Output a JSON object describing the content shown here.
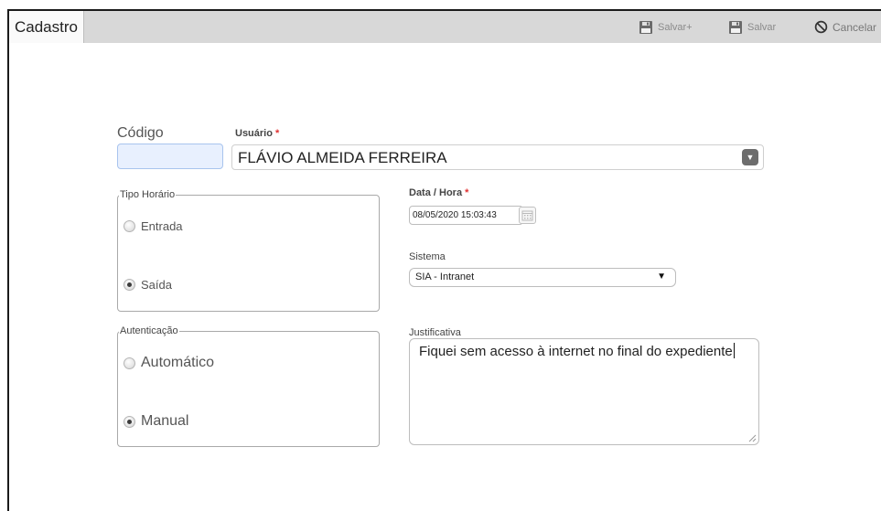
{
  "toolbar": {
    "tab_label": "Cadastro",
    "save_plus_label": "Salvar+",
    "save_label": "Salvar",
    "cancel_label": "Cancelar",
    "icons": {
      "save_plus": "floppy-disk-icon",
      "save": "floppy-disk-icon",
      "cancel": "circle-slash-icon"
    }
  },
  "form": {
    "codigo": {
      "label": "Código",
      "value": ""
    },
    "usuario": {
      "label": "Usuário",
      "required_mark": "*",
      "value": "FLÁVIO ALMEIDA FERREIRA"
    },
    "tipo_horario": {
      "legend": "Tipo Horário",
      "options": [
        "Entrada",
        "Saída"
      ],
      "selected": "Saída"
    },
    "autenticacao": {
      "legend": "Autenticação",
      "options": [
        "Automático",
        "Manual"
      ],
      "selected": "Manual"
    },
    "data_hora": {
      "label": "Data / Hora",
      "required_mark": "*",
      "value": "08/05/2020 15:03:43"
    },
    "sistema": {
      "label": "Sistema",
      "value": "SIA - Intranet"
    },
    "justificativa": {
      "label": "Justificativa",
      "value": "Fiquei sem acesso à internet no final do expediente"
    }
  },
  "colors": {
    "toolbar_bg": "#d8d8d8",
    "codigo_input_bg": "#e8f0fe",
    "required": "#e03030"
  }
}
